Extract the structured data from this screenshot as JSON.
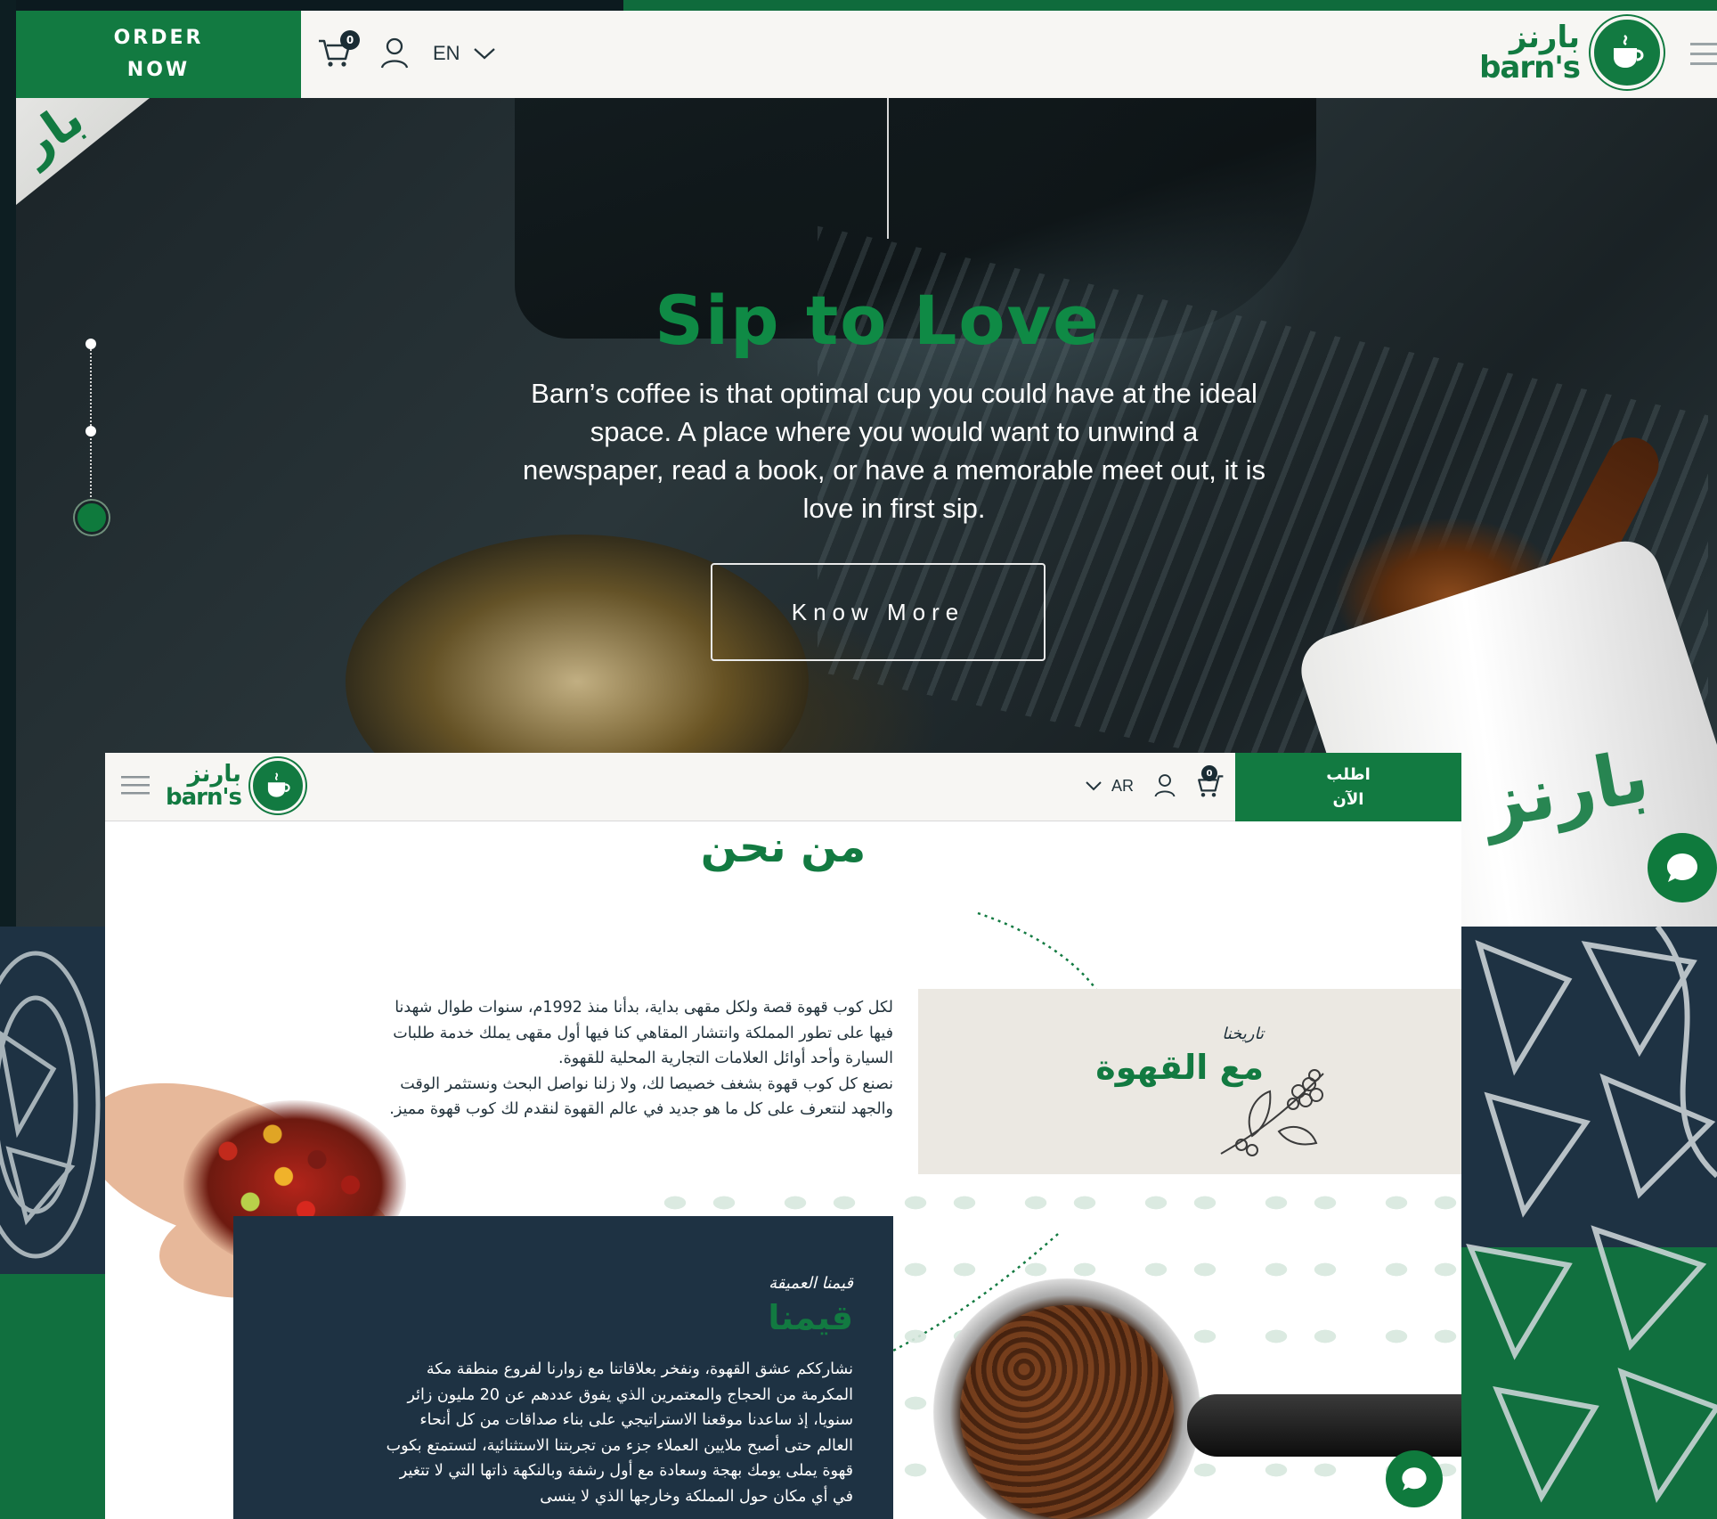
{
  "en_header": {
    "order_line1": "ORDER",
    "order_line2": "NOW",
    "cart_count": "0",
    "language": "EN",
    "logo_ar": "بارنز",
    "logo_en": "barn's"
  },
  "hero": {
    "title": "Sip to Love",
    "text": "Barn’s coffee is that optimal cup you could have at the ideal space. A place where you would want to unwind a newspaper, read a book, or have a memorable meet out, it is love in first sip.",
    "button_label": "Know More",
    "slides_total": 3,
    "active_slide": 3,
    "cup_brand": "بارنز"
  },
  "ar_header": {
    "order_line1": "اطلب",
    "order_line2": "الآن",
    "language": "AR",
    "cart_count": "0",
    "logo_ar": "بارنز",
    "logo_en": "barn's"
  },
  "about": {
    "title": "من نحن",
    "history_subtitle": "تاريخنا",
    "history_title": "مع القهوة",
    "paragraph1": "لكل كوب قهوة قصة ولكل مقهى بداية، بدأنا منذ 1992م، سنوات طوال شهدنا فيها على تطور المملكة وانتشار المقاهي كنا فيها أول مقهى يملك خدمة طلبات السيارة وأحد أوائل العلامات التجارية المحلية للقهوة.",
    "paragraph2": "نصنع كل كوب قهوة بشغف خصيصا لك، ولا زلنا نواصل البحث ونستثمر الوقت والجهد لنتعرف على كل ما هو جديد في عالم القهوة لنقدم لك كوب قهوة مميز.",
    "values_subtitle": "قيمنا العميقة",
    "values_title": "قيمنا",
    "values_text": "نشارككم عشق القهوة، ونفخر بعلاقاتنا مع زوارنا لفروع منطقة مكة المكرمة من الحجاج والمعتمرين الذي يفوق عددهم عن 20 مليون زائر سنويا، إذ ساعدنا موقعنا الاستراتيجي على بناء صداقات من كل أنحاء العالم حتى أصبح ملايين العملاء جزء من تجربتنا الاستثنائية، لتستمتع بكوب قهوة يملى يومك بهجة وسعادة مع أول رشفة وبالنكهة ذاتها التي لا تتغير في أي مكان حول المملكة وخارجها الذي لا ينسى"
  },
  "colors": {
    "brand_green": "#127a41",
    "navy": "#1e3243",
    "cream": "#f7f6f3",
    "beige_card": "#ebe8e2"
  },
  "icons": [
    "cart-icon",
    "user-icon",
    "chevron-down-icon",
    "hamburger-icon",
    "chat-icon",
    "coffee-cup-icon",
    "coffee-branch-icon"
  ]
}
